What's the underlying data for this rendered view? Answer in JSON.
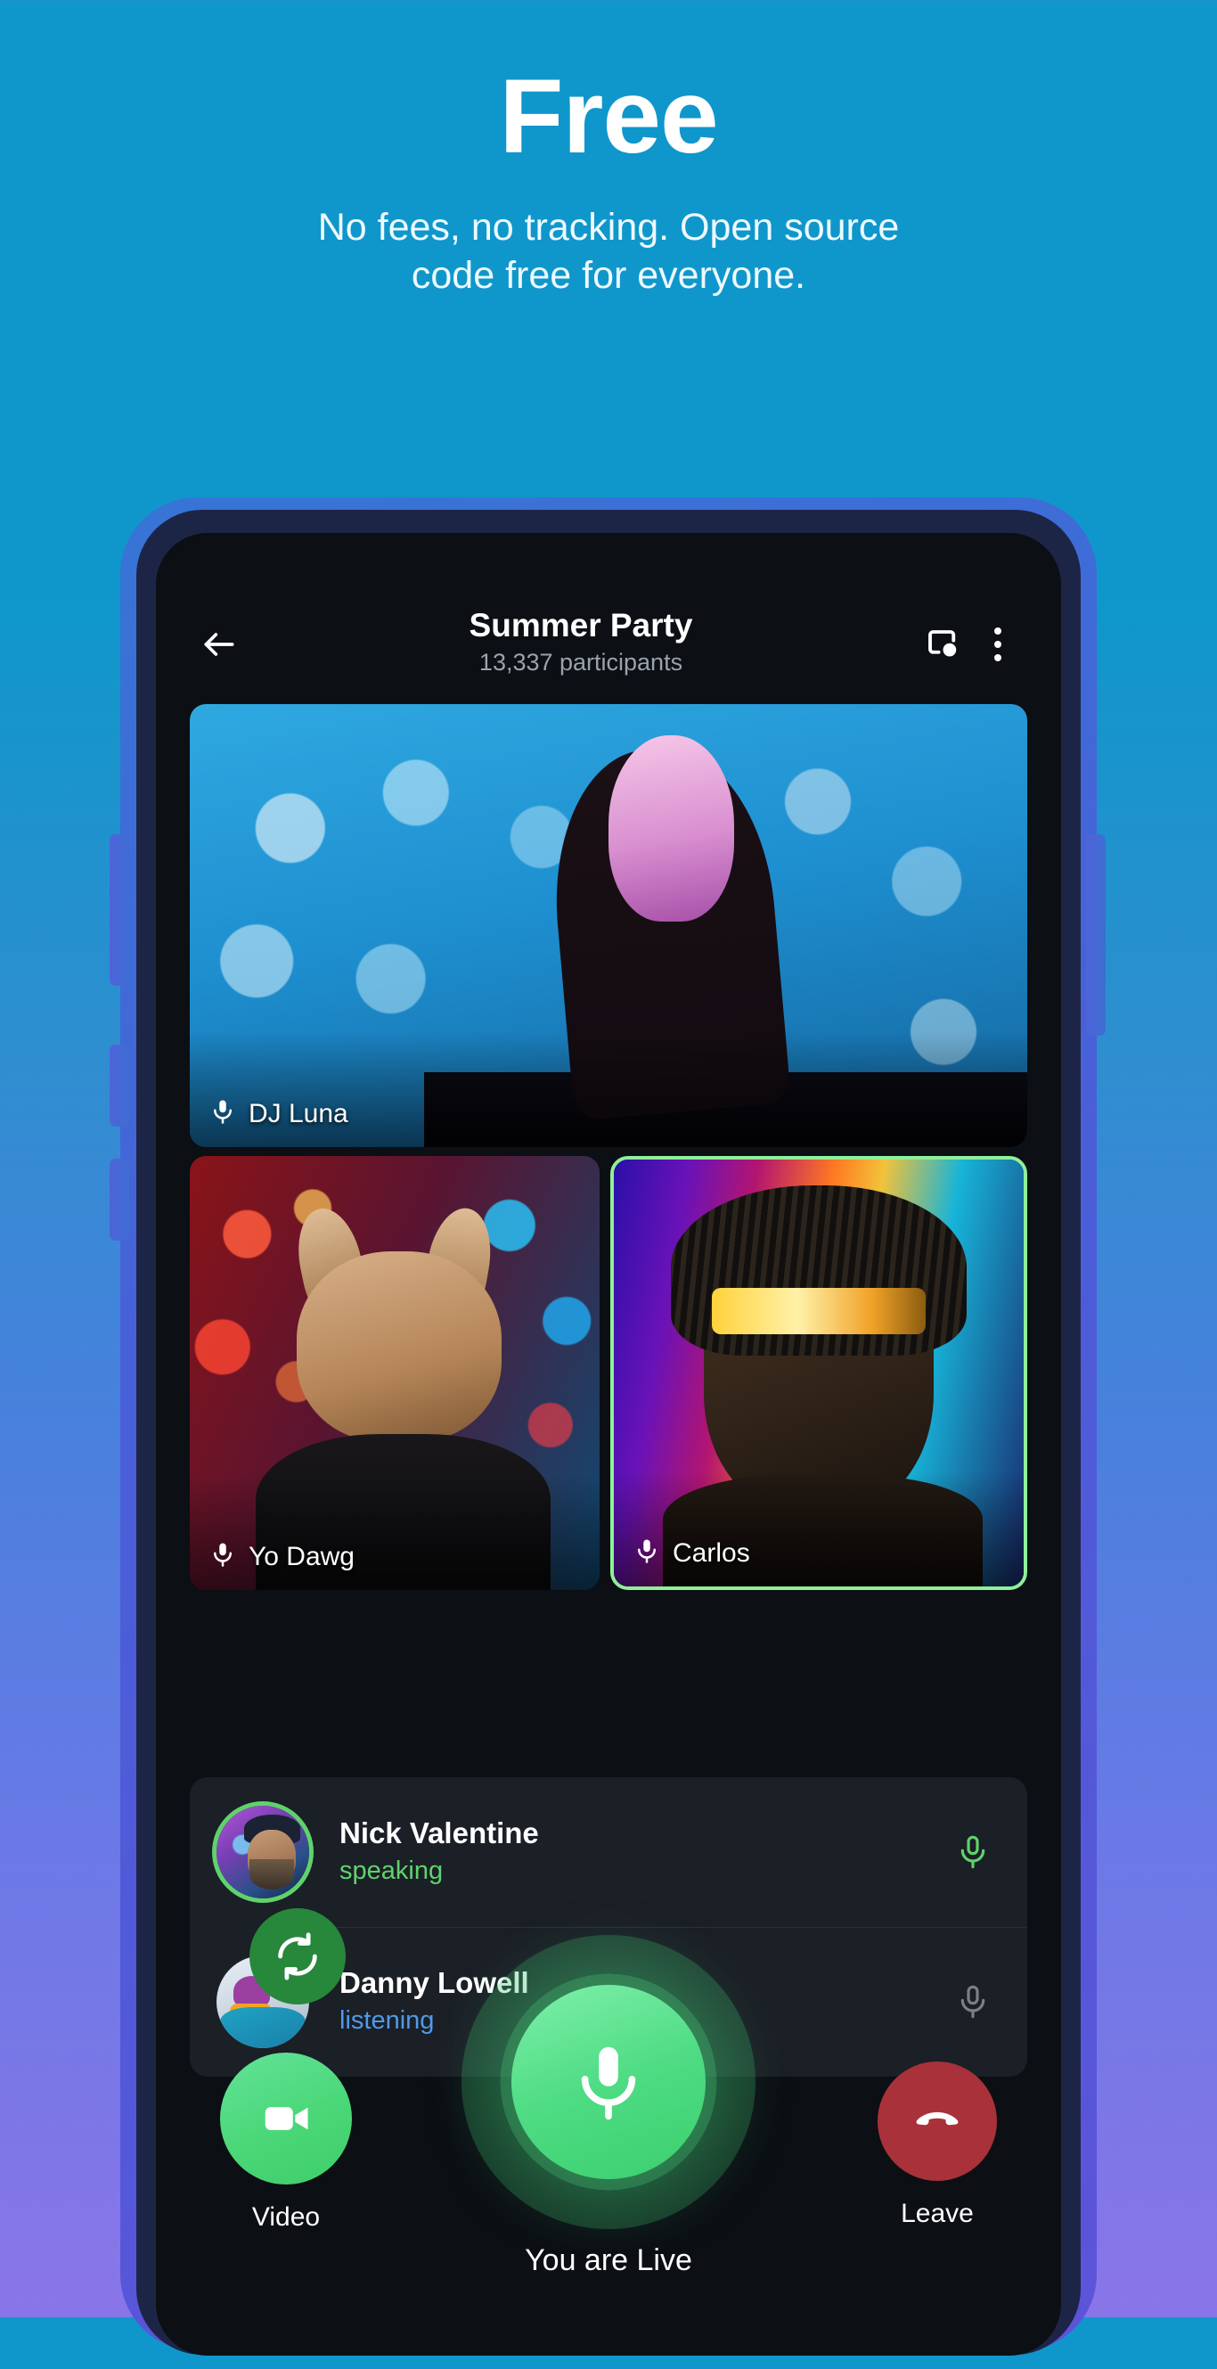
{
  "promo": {
    "title": "Free",
    "subtitle_line1": "No fees, no tracking. Open source",
    "subtitle_line2": "code free for everyone.",
    "bg_top_color": "#0f97cb",
    "bg_bottom_color": "#8a75e8"
  },
  "app": {
    "header": {
      "back_icon": "back-arrow-icon",
      "title": "Summer Party",
      "subtitle": "13,337 participants",
      "cast_icon": "screen-share-icon",
      "menu_icon": "overflow-menu-icon"
    },
    "video_tiles": [
      {
        "name": "DJ Luna",
        "mic_icon": "microphone-icon",
        "active_speaker": false
      },
      {
        "name": "Yo Dawg",
        "mic_icon": "microphone-icon",
        "active_speaker": false
      },
      {
        "name": "Carlos",
        "mic_icon": "microphone-icon",
        "active_speaker": true
      }
    ],
    "participants": [
      {
        "name": "Nick Valentine",
        "status": "speaking",
        "mic_icon": "microphone-icon",
        "mic_state": "on",
        "ring": true
      },
      {
        "name": "Danny Lowell",
        "status": "listening",
        "mic_icon": "microphone-icon",
        "mic_state": "off",
        "ring": false
      }
    ],
    "controls": {
      "flip_camera_icon": "flip-camera-icon",
      "video_icon": "video-camera-icon",
      "video_label": "Video",
      "mic_icon": "microphone-icon",
      "live_label": "You are Live",
      "leave_icon": "hang-up-icon",
      "leave_label": "Leave"
    },
    "colors": {
      "speaking_green": "#5fd36b",
      "listening_blue": "#4f9ae8",
      "active_border": "#8ff09a",
      "leave_red": "#a8313a",
      "mic_green": "#4fdc84"
    }
  }
}
